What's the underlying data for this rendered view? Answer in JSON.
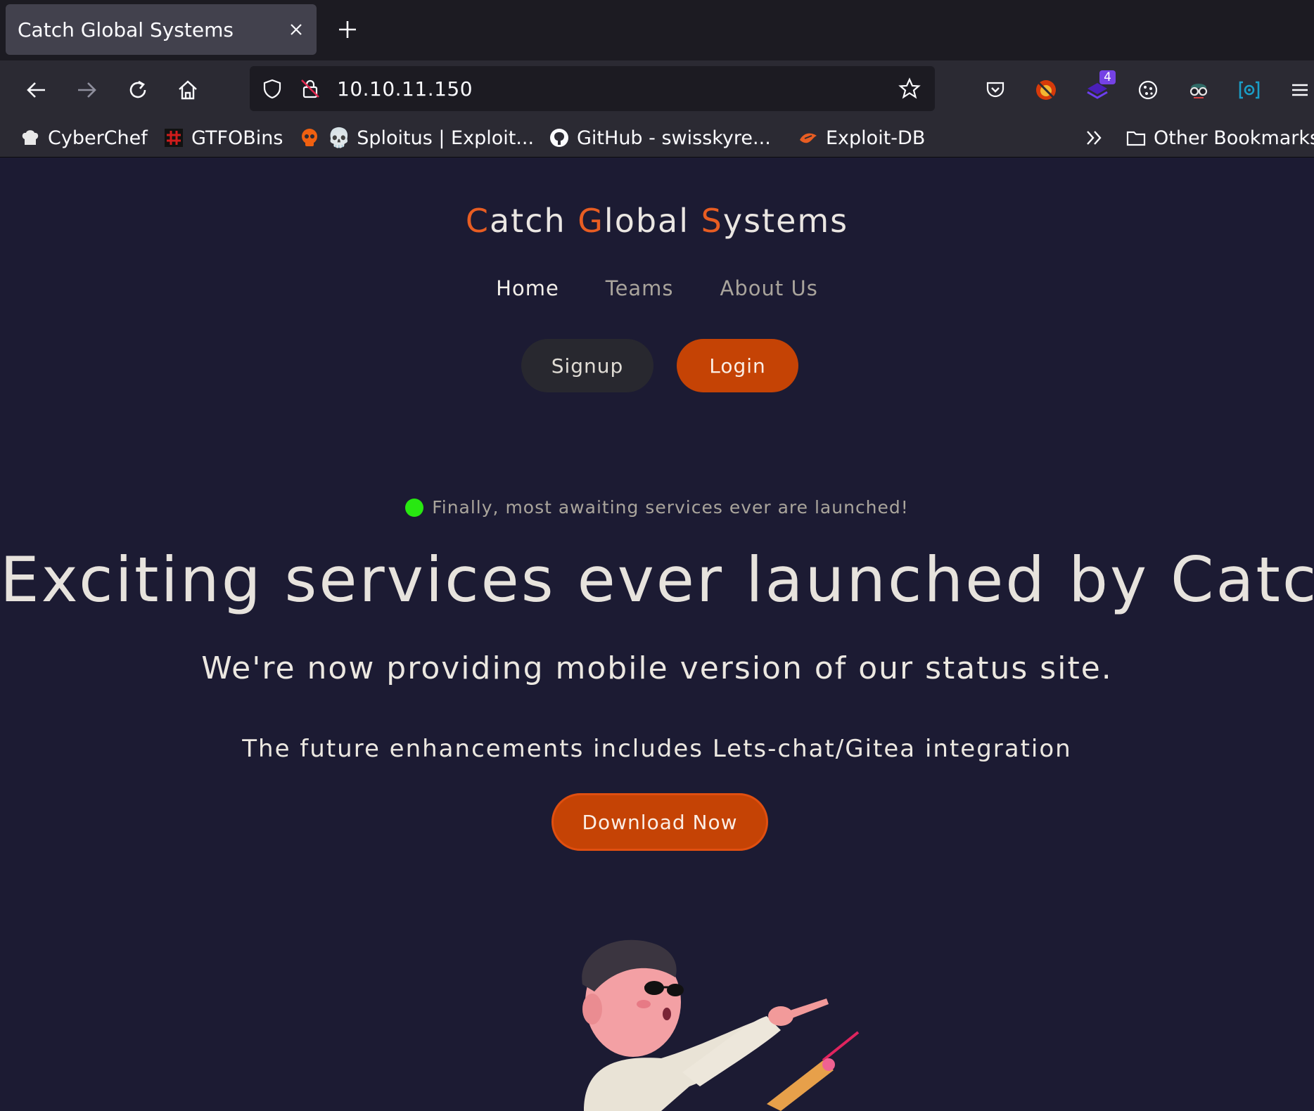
{
  "browser": {
    "tab": {
      "title": "Catch Global Systems"
    },
    "url": "10.10.11.150",
    "toolbar_extensions": [
      {
        "icon": "pocket-icon"
      },
      {
        "icon": "ublock-icon"
      },
      {
        "icon": "extension-stack-icon",
        "badge": "4"
      },
      {
        "icon": "cookie-icon"
      },
      {
        "icon": "spy-glasses-icon"
      },
      {
        "icon": "wappalyzer-icon"
      }
    ],
    "bookmarks": [
      {
        "label": "CyberChef",
        "icon": "chef-hat-icon"
      },
      {
        "label": "GTFOBins",
        "icon": "gtfobins-icon"
      },
      {
        "label": "💀 Sploitus | Exploit...",
        "icon": "skull-icon"
      },
      {
        "label": "GitHub - swisskyre...",
        "icon": "github-icon"
      },
      {
        "label": "Exploit-DB",
        "icon": "exploitdb-icon"
      }
    ],
    "other_bookmarks": "Other Bookmarks"
  },
  "site": {
    "brand_parts": [
      {
        "accent": "C",
        "rest": "atch "
      },
      {
        "accent": "G",
        "rest": "lobal "
      },
      {
        "accent": "S",
        "rest": "ystems"
      }
    ],
    "nav": [
      "Home",
      "Teams",
      "About Us"
    ],
    "signup_label": "Signup",
    "login_label": "Login",
    "status_text": "Finally, most awaiting services ever are launched!",
    "hero_title": "Exciting services ever launched by Catch!",
    "subtitle": "We're now providing mobile version of our status site.",
    "subtitle2": "The future enhancements includes Lets-chat/Gitea integration",
    "download_label": "Download Now"
  },
  "colors": {
    "accent": "#e85d22",
    "button": "#c54305",
    "page_bg": "#1c1b33",
    "status_dot": "#28e811"
  }
}
